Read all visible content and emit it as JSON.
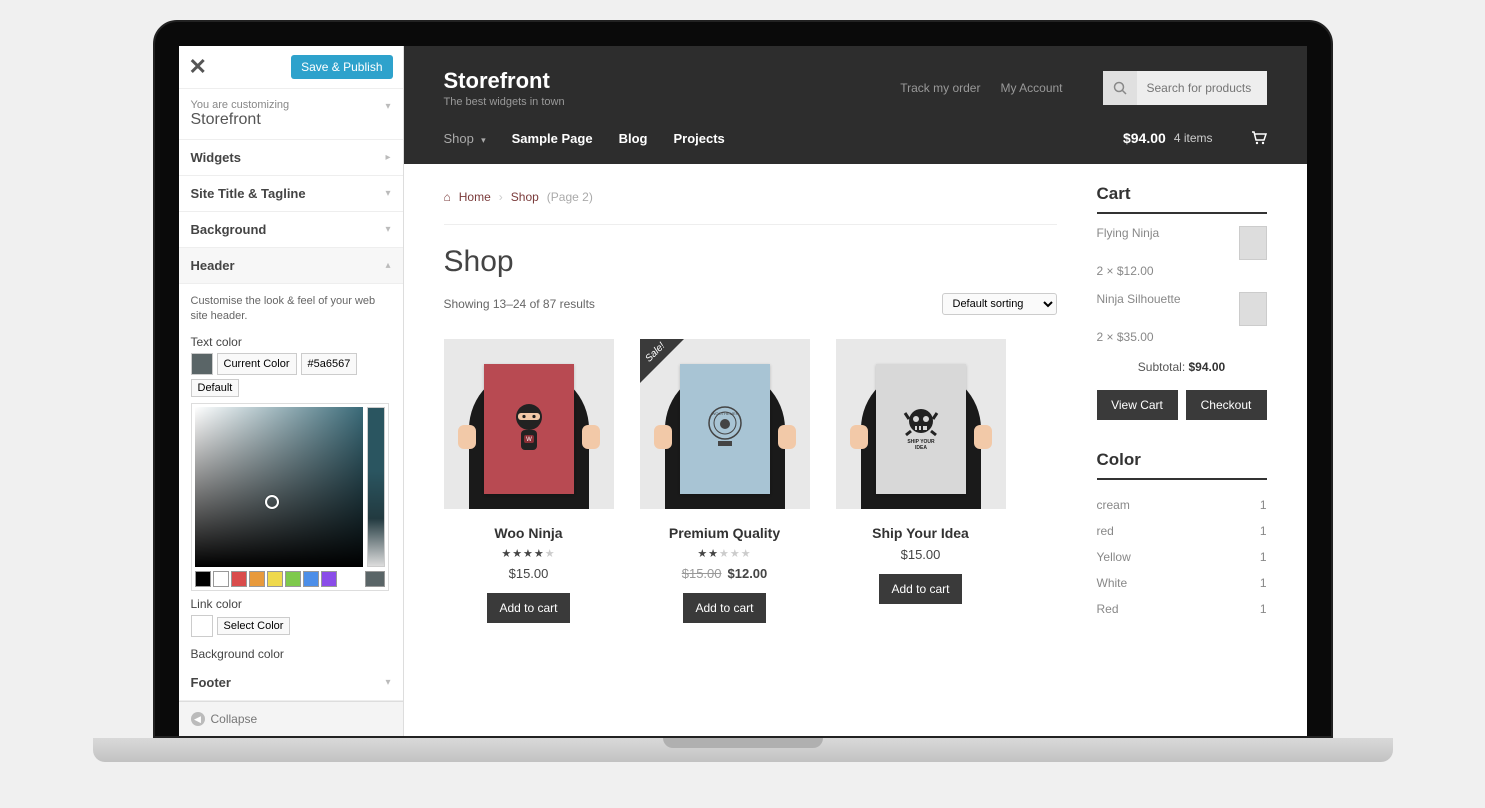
{
  "customizer": {
    "save_label": "Save & Publish",
    "customizing_label": "You are customizing",
    "site_name": "Storefront",
    "sections": {
      "widgets": "Widgets",
      "site_title": "Site Title & Tagline",
      "background": "Background",
      "header": "Header",
      "footer": "Footer"
    },
    "header_desc": "Customise the look & feel of your web site header.",
    "text_color_label": "Text color",
    "current_color_label": "Current Color",
    "hex_value": "#5a6567",
    "default_label": "Default",
    "link_color_label": "Link color",
    "select_color_label": "Select Color",
    "bg_color_label": "Background color",
    "collapse_label": "Collapse",
    "palette": [
      "#000000",
      "#ffffff",
      "#d94c4c",
      "#e89a3c",
      "#efd94c",
      "#7ec94c",
      "#4c8ee8",
      "#8a4ce8"
    ]
  },
  "site": {
    "title": "Storefront",
    "tagline": "The best widgets in town",
    "links": {
      "track": "Track my order",
      "account": "My Account"
    },
    "search_placeholder": "Search for products",
    "nav": {
      "shop": "Shop",
      "sample": "Sample Page",
      "blog": "Blog",
      "projects": "Projects"
    },
    "cart_total": "$94.00",
    "cart_count": "4 items"
  },
  "breadcrumb": {
    "home": "Home",
    "shop": "Shop",
    "page": "(Page 2)"
  },
  "shop": {
    "heading": "Shop",
    "results": "Showing 13–24 of 87 results",
    "sort": "Default sorting",
    "add_to_cart": "Add to cart",
    "products": [
      {
        "name": "Woo Ninja",
        "rating": 4,
        "price": "$15.00",
        "sale": false,
        "poster_bg": "#b84a52",
        "icon": "ninja"
      },
      {
        "name": "Premium Quality",
        "rating": 2,
        "old_price": "$15.00",
        "price": "$12.00",
        "sale": true,
        "sale_label": "Sale!",
        "poster_bg": "#a8c4d4",
        "icon": "badge"
      },
      {
        "name": "Ship Your Idea",
        "rating": 0,
        "price": "$15.00",
        "sale": false,
        "poster_bg": "#d8d8d8",
        "icon": "skull"
      }
    ]
  },
  "cart_widget": {
    "title": "Cart",
    "items": [
      {
        "name": "Flying Ninja",
        "line": "2 × $12.00"
      },
      {
        "name": "Ninja Silhouette",
        "line": "2 × $35.00"
      }
    ],
    "subtotal_label": "Subtotal:",
    "subtotal_value": "$94.00",
    "view_cart": "View Cart",
    "checkout": "Checkout"
  },
  "color_widget": {
    "title": "Color",
    "rows": [
      {
        "name": "cream",
        "count": "1"
      },
      {
        "name": "red",
        "count": "1"
      },
      {
        "name": "Yellow",
        "count": "1"
      },
      {
        "name": "White",
        "count": "1"
      },
      {
        "name": "Red",
        "count": "1"
      }
    ]
  }
}
